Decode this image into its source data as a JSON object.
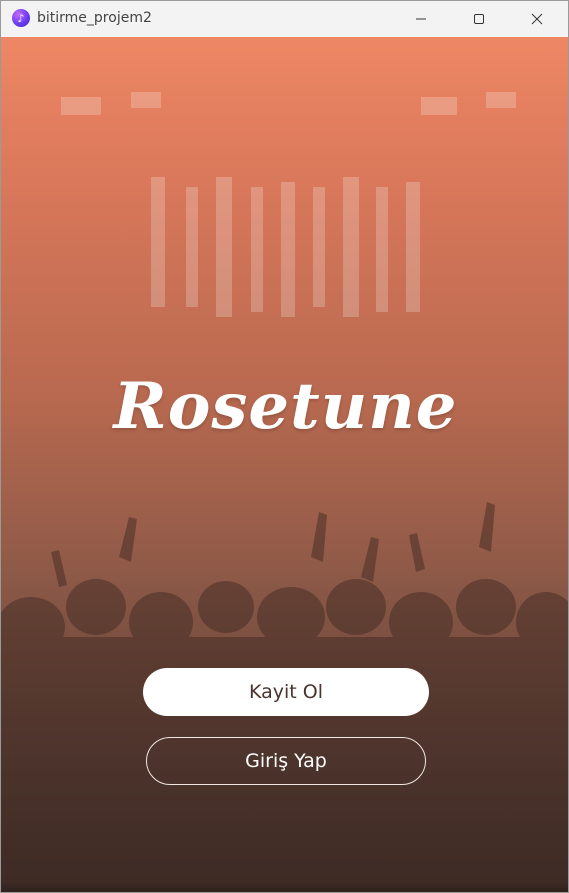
{
  "window": {
    "title": "bitirme_projem2",
    "icon": "app-music-icon",
    "controls": [
      "minimize-icon",
      "maximize-icon",
      "close-icon"
    ]
  },
  "app": {
    "logo_text": "Rosetune",
    "register_label": "Kayit Ol",
    "login_label": "Giriş Yap"
  },
  "colors": {
    "gradient_top": "#ee8764",
    "gradient_bottom": "#3f2e28",
    "primary_button_bg": "#ffffff",
    "primary_button_text": "#4a342d",
    "secondary_button_border": "#f1e7e3"
  }
}
